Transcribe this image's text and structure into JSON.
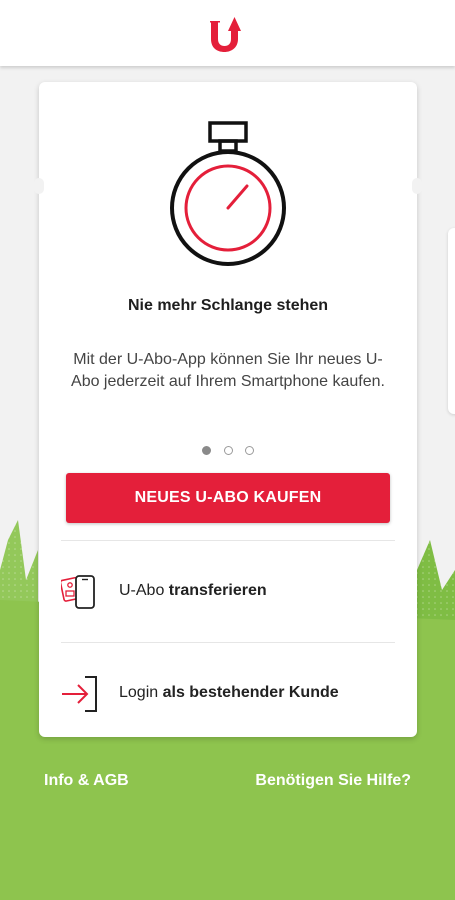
{
  "header": {
    "logo_letter": "U",
    "logo_color": "#e41f3a"
  },
  "onboarding": {
    "icon": "stopwatch-icon",
    "title": "Nie mehr Schlange stehen",
    "text": "Mit der U-Abo-App können Sie Ihr neues U-Abo jederzeit auf Ihrem Smartphone kaufen.",
    "pagination": {
      "total": 3,
      "active": 1
    }
  },
  "buy_button_label": "NEUES U-ABO KAUFEN",
  "actions": {
    "transfer": {
      "icon": "phone-transfer-icon",
      "prefix": "U-Abo ",
      "bold": "transferieren"
    },
    "login": {
      "icon": "login-arrow-icon",
      "prefix": "Login ",
      "bold": "als bestehender Kunde"
    }
  },
  "footer": {
    "info_label": "Info & AGB",
    "help_label": "Benötigen Sie Hilfe?"
  },
  "colors": {
    "accent": "#e41f3a",
    "green": "#8ec44e",
    "green_dark": "#6fae31"
  }
}
